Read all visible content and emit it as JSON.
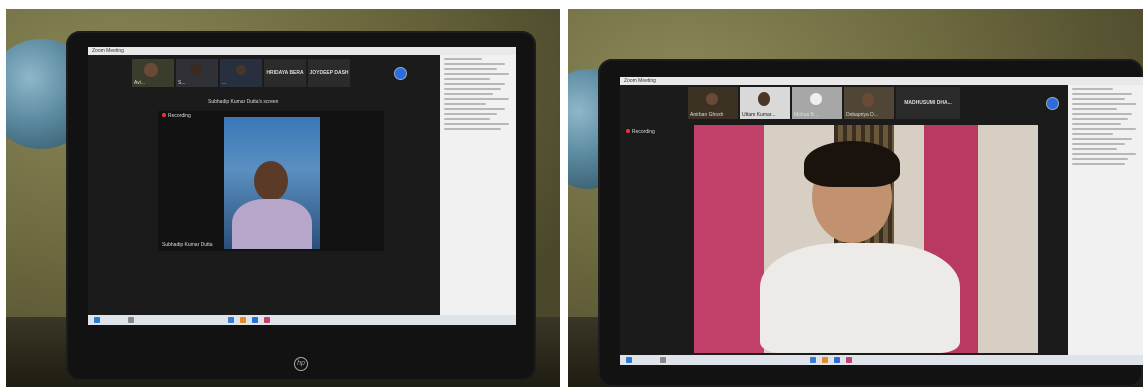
{
  "photos": [
    {
      "window_title": "Zoom Meeting",
      "participants": [
        {
          "name": "Avi..."
        },
        {
          "name": "S..."
        },
        {
          "name": "..."
        }
      ],
      "text_tiles": [
        "HRIDAYA BERA",
        "JOYDEEP DASH"
      ],
      "speaker_label": "Subhadip Kumar Dutta's screen",
      "speaker_caption": "Subhadip Kumar Dutta",
      "recording_label": "Recording"
    },
    {
      "window_title": "Zoom Meeting",
      "participants": [
        {
          "name": "Anirban Ghosh"
        },
        {
          "name": "Uttam Kumar..."
        },
        {
          "name": "Mohua B..."
        },
        {
          "name": "Debapriya D..."
        }
      ],
      "text_tiles": [
        "MADHUSUMI DHA..."
      ],
      "recording_label": "Recording"
    }
  ],
  "colors": {
    "zoom_blue": "#2d6cdf",
    "laptop": "#121212",
    "wall": "#6d6a40",
    "pink_wall": "#c2416b"
  },
  "icons": [
    "hp-logo-icon",
    "next-page-icon"
  ]
}
